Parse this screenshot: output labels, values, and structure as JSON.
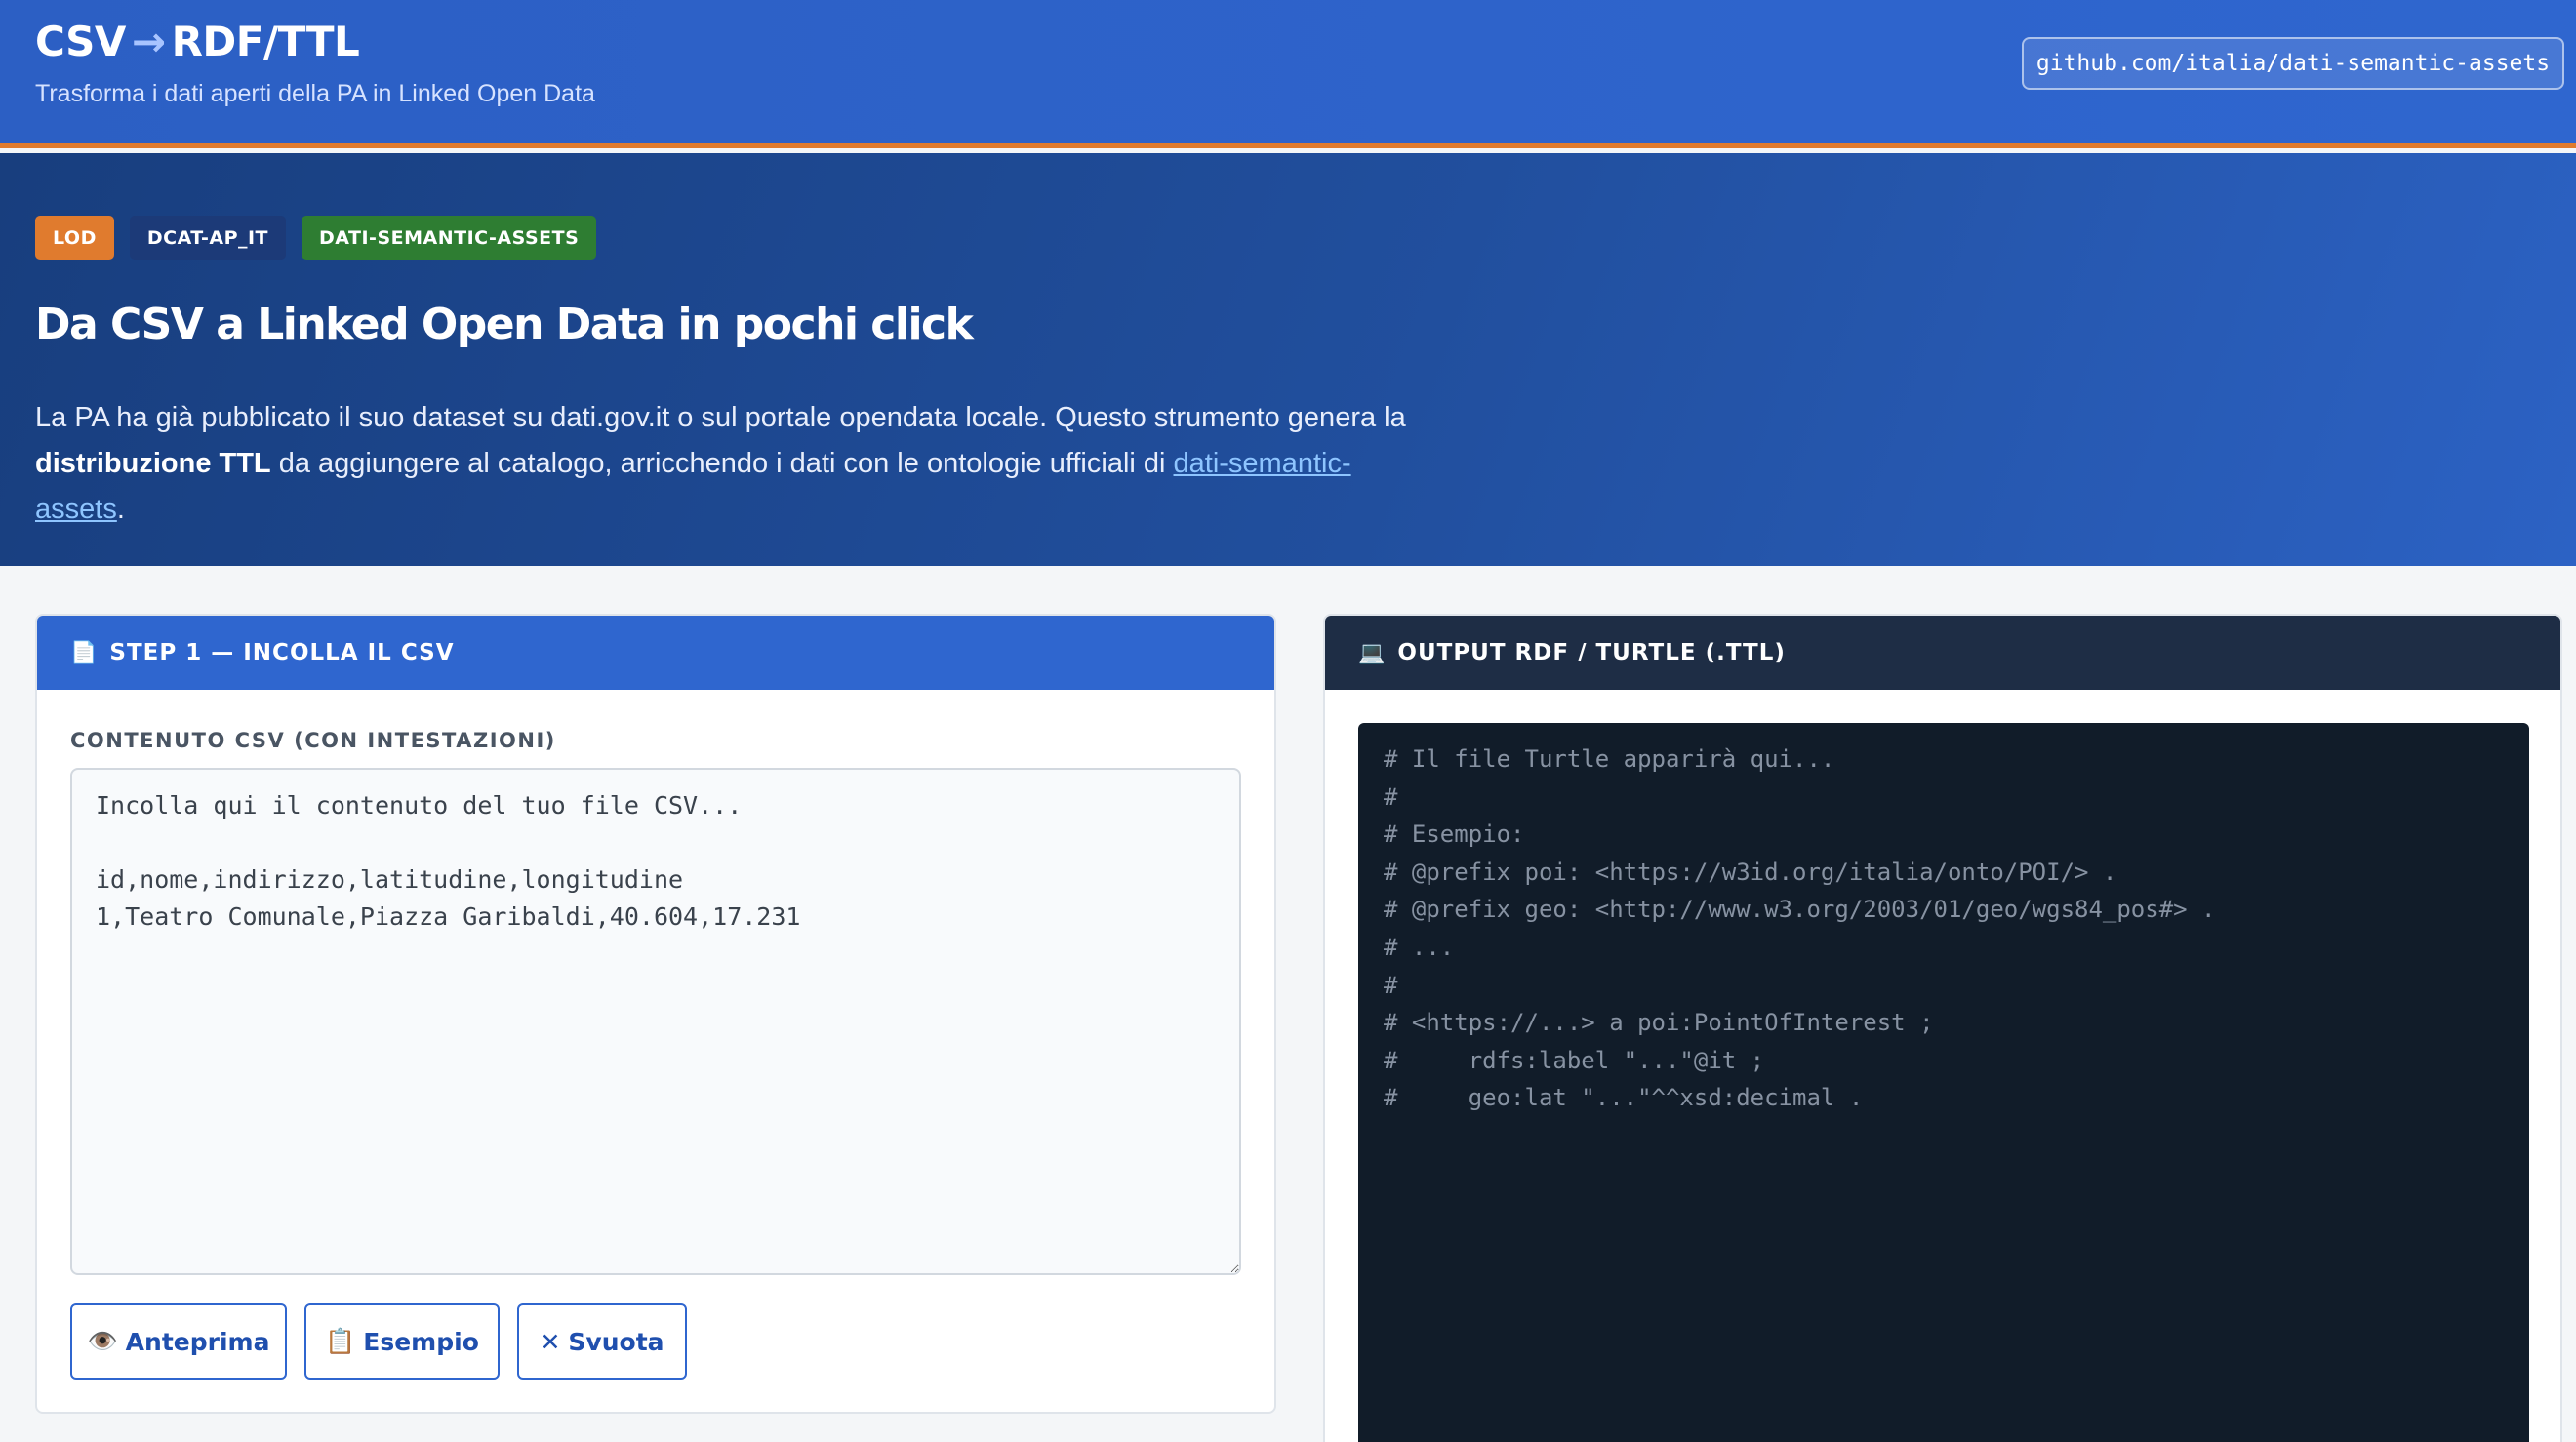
{
  "header": {
    "title_left": "CSV",
    "title_arrow": "→",
    "title_right": "RDF/TTL",
    "subtitle": "Trasforma i dati aperti della PA in Linked Open Data",
    "repo_link": "github.com/italia/dati-semantic-assets"
  },
  "hero": {
    "badges": [
      "LOD",
      "DCAT-AP_IT",
      "DATI-SEMANTIC-ASSETS"
    ],
    "title": "Da CSV a Linked Open Data in pochi click",
    "desc_part1": "La PA ha già pubblicato il suo dataset su dati.gov.it o sul portale opendata locale. Questo strumento genera la ",
    "desc_strong": "distribuzione TTL",
    "desc_part2": " da aggiungere al catalogo, arricchendo i dati con le ontologie ufficiali di ",
    "desc_link": "dati-semantic-assets",
    "desc_end": "."
  },
  "step1": {
    "icon": "page-icon",
    "title": "STEP 1 — INCOLLA IL CSV",
    "field_label": "CONTENUTO CSV (CON INTESTAZIONI)",
    "placeholder": "Incolla qui il contenuto del tuo file CSV...\n\nid,nome,indirizzo,latitudine,longitudine\n1,Teatro Comunale,Piazza Garibaldi,40.604,17.231",
    "buttons": {
      "preview_icon": "eye-icon",
      "preview": "Anteprima",
      "example_icon": "clipboard-icon",
      "example": "Esempio",
      "clear_icon": "x-icon",
      "clear": "Svuota"
    }
  },
  "output": {
    "icon": "laptop-icon",
    "title": "OUTPUT RDF / TURTLE (.TTL)",
    "placeholder_text": "# Il file Turtle apparirà qui...\n#\n# Esempio:\n# @prefix poi: <https://w3id.org/italia/onto/POI/> .\n# @prefix geo: <http://www.w3.org/2003/01/geo/wgs84_pos#> .\n# ...\n#\n# <https://...> a poi:PointOfInterest ;\n#     rdfs:label \"...\"@it ;\n#     geo:lat \"...\"^^xsd:decimal ."
  },
  "colors": {
    "primary": "#2f66cf",
    "accent_orange": "#e07b2e",
    "navy": "#1c3a78",
    "green": "#2e7d32",
    "code_bg": "#111c29"
  }
}
